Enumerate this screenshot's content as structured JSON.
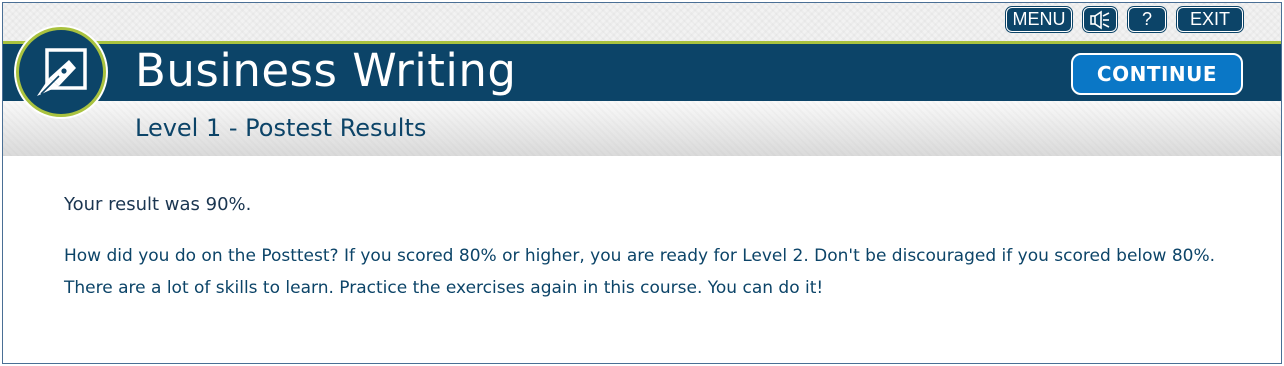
{
  "topnav": {
    "menu_label": "MENU",
    "audio_icon": "speaker-icon",
    "help_label": "?",
    "exit_label": "EXIT"
  },
  "header": {
    "logo_icon": "pen-nib-icon",
    "title": "Business Writing",
    "continue_label": "CONTINUE",
    "subtitle": "Level 1 - Postest Results"
  },
  "main": {
    "result_text": "Your result was 90%.",
    "message": "How did you do on the Posttest? If you scored 80% or higher, you are ready for Level 2. Don't be discouraged if you scored below 80%. There are a lot of skills to learn. Practice the exercises again in this course. You can do it!"
  },
  "colors": {
    "brand_navy": "#0c4468",
    "accent_green": "#a9c23f",
    "continue_blue": "#0a77c6"
  }
}
